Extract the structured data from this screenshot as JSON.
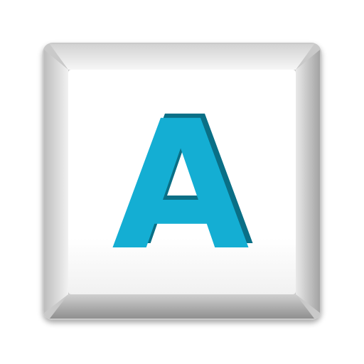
{
  "key": {
    "letter": "A",
    "letter_color": "#14aed3",
    "letter_shadow_color": "#0a6f86",
    "cap_color": "#ffffff",
    "bevel_light": "#fafafa",
    "bevel_dark": "#9c9c9c",
    "icon": "keyboard-key-icon"
  }
}
